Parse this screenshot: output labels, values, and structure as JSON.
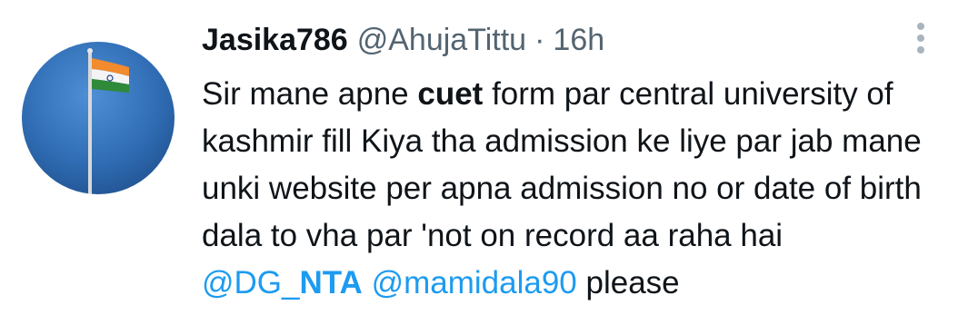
{
  "tweet": {
    "display_name": "Jasika786",
    "handle": "@AhujaTittu",
    "separator": "·",
    "timestamp": "16h",
    "more_icon": "more-vertical-icon",
    "avatar_icon": "flagpole-avatar-image",
    "text_parts": {
      "before_bold": "Sir mane apne ",
      "bold": "cuet",
      "after_bold": " form par central university of kashmir fill Kiya tha admission ke liye par jab mane unki website per apna admission no or date of birth dala to vha par 'not on record aa raha hai  ",
      "mention1_prefix": "@DG_",
      "mention1_bold": "NTA",
      "space": " ",
      "mention2": "@mamidala90",
      "after_mentions": " please"
    }
  },
  "colors": {
    "text": "#0f1419",
    "secondary": "#536471",
    "link": "#1d9bf0",
    "sky": "#2e6fb8"
  }
}
